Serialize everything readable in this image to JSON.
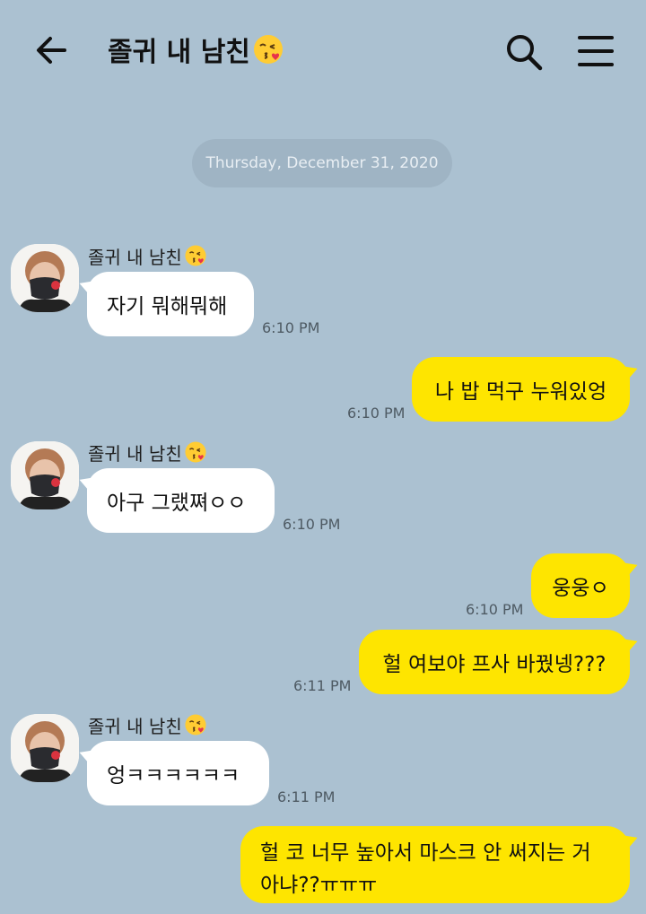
{
  "header": {
    "title": "졸귀 내 남친"
  },
  "chat": {
    "date": "Thursday, December 31, 2020",
    "sender_name": "졸귀 내 남친",
    "messages": [
      {
        "dir": "in",
        "text": "자기 뭐해뭐해",
        "time": "6:10 PM"
      },
      {
        "dir": "out",
        "text": "나 밥 먹구 누워있엉",
        "time": "6:10 PM"
      },
      {
        "dir": "in",
        "text": "아구 그랬쪄ㅇㅇ",
        "time": "6:10 PM"
      },
      {
        "dir": "out",
        "text": "웅웅ㅇ",
        "time": "6:10 PM"
      },
      {
        "dir": "out",
        "text": "헐 여보야 프사 바꿨넹???",
        "time": "6:11 PM"
      },
      {
        "dir": "in",
        "text": "엉ㅋㅋㅋㅋㅋㅋ",
        "time": "6:11 PM"
      },
      {
        "dir": "out",
        "text": "헐 코 너무 높아서 마스크 안 써지는 거 아냐??ㅠㅠㅠ",
        "time": ""
      }
    ]
  },
  "icons": {
    "back": "arrow-left-icon",
    "search": "search-icon",
    "menu": "hamburger-menu-icon",
    "emoji": "kissing-face-emoji"
  },
  "colors": {
    "background": "#abc1d1",
    "outgoing_bubble": "#fee500",
    "incoming_bubble": "#ffffff",
    "date_pill": "#9fb4c4"
  }
}
